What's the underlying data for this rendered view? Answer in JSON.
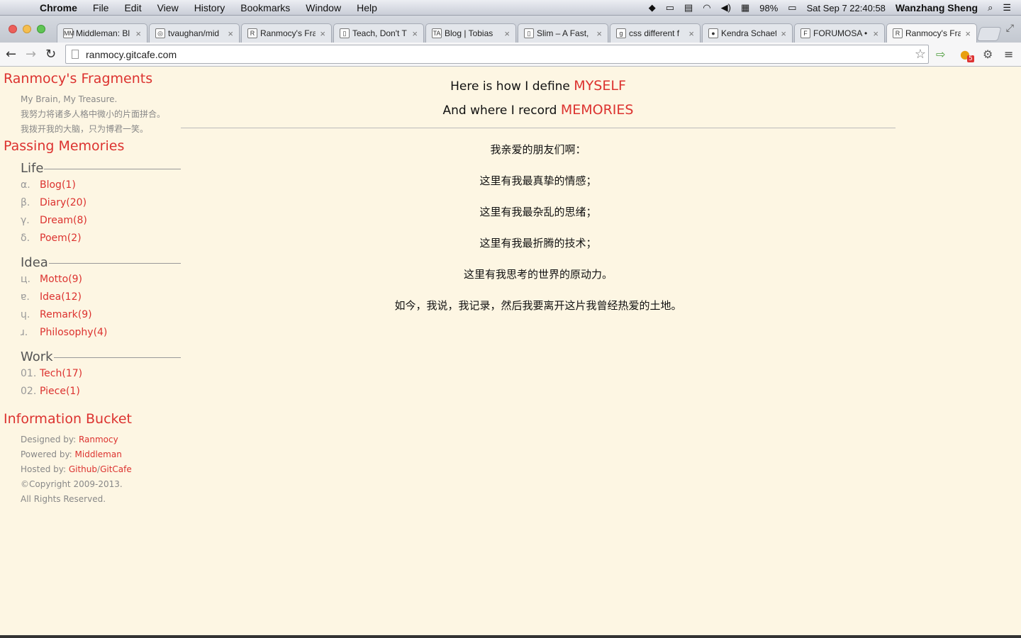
{
  "menubar": {
    "app": "Chrome",
    "items": [
      "File",
      "Edit",
      "View",
      "History",
      "Bookmarks",
      "Window",
      "Help"
    ],
    "battery": "98%",
    "clock": "Sat Sep 7  22:40:58",
    "user": "Wanzhang Sheng"
  },
  "tabs": [
    {
      "label": "Middleman: Bl",
      "fav": "MM"
    },
    {
      "label": "tvaughan/mid",
      "fav": "◎"
    },
    {
      "label": "Ranmocy's Fra",
      "fav": "R"
    },
    {
      "label": "Teach, Don't T",
      "fav": "▯"
    },
    {
      "label": "Blog | Tobias",
      "fav": "TA"
    },
    {
      "label": "Slim – A Fast,",
      "fav": "▯"
    },
    {
      "label": "css different f",
      "fav": "g"
    },
    {
      "label": "Kendra Schaef",
      "fav": "●"
    },
    {
      "label": "FORUMOSA •",
      "fav": "F"
    },
    {
      "label": "Ranmocy's Fra",
      "fav": "R"
    }
  ],
  "toolbar": {
    "url": "ranmocy.gitcafe.com",
    "extension_badge": "5"
  },
  "sidebar": {
    "fragments_title": "Ranmocy's Fragments",
    "fragments_lines": [
      "My Brain, My Treasure.",
      "我努力将诸多人格中微小的片面拼合。",
      "我拨开我的大脑，只为博君一笑。"
    ],
    "memories_title": "Passing Memories",
    "groups": [
      {
        "name": "Life",
        "items": [
          {
            "marker": "α.",
            "label": "Blog(1)"
          },
          {
            "marker": "β.",
            "label": "Diary(20)"
          },
          {
            "marker": "γ.",
            "label": "Dream(8)"
          },
          {
            "marker": "δ.",
            "label": "Poem(2)"
          }
        ]
      },
      {
        "name": "Idea",
        "items": [
          {
            "marker": "ц.",
            "label": "Motto(9)"
          },
          {
            "marker": "ɐ.",
            "label": "Idea(12)"
          },
          {
            "marker": "ɥ.",
            "label": "Remark(9)"
          },
          {
            "marker": "ɹ.",
            "label": "Philosophy(4)"
          }
        ]
      },
      {
        "name": "Work",
        "items": [
          {
            "marker": "01.",
            "label": "Tech(17)"
          },
          {
            "marker": "02.",
            "label": "Piece(1)"
          }
        ]
      }
    ],
    "bucket_title": "Information Bucket",
    "bucket": {
      "designed_prefix": "Designed by: ",
      "designed_link": "Ranmocy",
      "powered_prefix": "Powered by: ",
      "powered_link": "Middleman",
      "hosted_prefix": "Hosted by: ",
      "hosted_link1": "Github",
      "hosted_sep": "/",
      "hosted_link2": "GitCafe",
      "copyright": "©Copyright 2009-2013.",
      "rights": "All Rights Reserved."
    }
  },
  "main": {
    "line1_prefix": "Here is how I define ",
    "line1_highlight": "MYSELF",
    "line2_prefix": "And where I record ",
    "line2_highlight": "MEMORIES",
    "paragraphs": [
      "我亲爱的朋友们啊：",
      "这里有我最真挚的情感；",
      "这里有我最杂乱的思绪；",
      "这里有我最折腾的技术；",
      "这里有我思考的世界的原动力。",
      "如今，我说，我记录，然后我要离开这片我曾经热爱的土地。"
    ]
  }
}
